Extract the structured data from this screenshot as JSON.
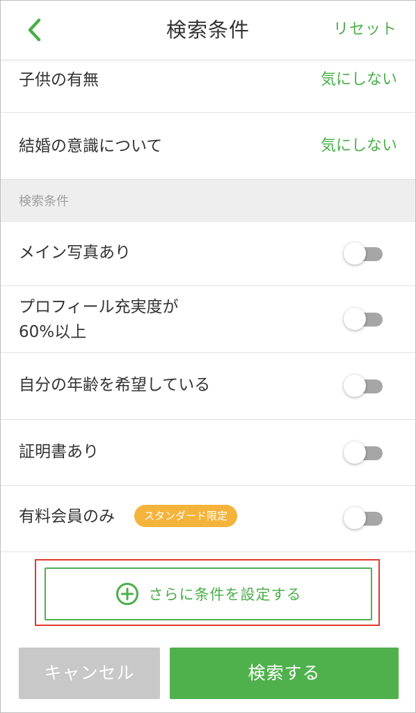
{
  "header": {
    "title": "検索条件",
    "reset_label": "リセット",
    "back_icon": "chevron-left-icon"
  },
  "rows": [
    {
      "label": "子供の有無",
      "value": "気にしない"
    },
    {
      "label": "結婚の意識について",
      "value": "気にしない"
    }
  ],
  "section": {
    "title": "検索条件"
  },
  "toggles": [
    {
      "label": "メイン写真あり",
      "on": false
    },
    {
      "label": "プロフィール充実度が",
      "label2": "60%以上",
      "on": false
    },
    {
      "label": "自分の年齢を希望している",
      "on": false
    },
    {
      "label": "証明書あり",
      "on": false
    },
    {
      "label": "有料会員のみ",
      "badge": "スタンダード限定",
      "on": false
    }
  ],
  "add_condition": {
    "label": "さらに条件を設定する",
    "icon": "plus-circle-icon"
  },
  "buttons": {
    "cancel": "キャンセル",
    "search": "検索する"
  },
  "colors": {
    "accent": "#4aae4a",
    "badge": "#f4b33a",
    "highlight": "#e03a2a",
    "cancel": "#c8c8c8"
  }
}
